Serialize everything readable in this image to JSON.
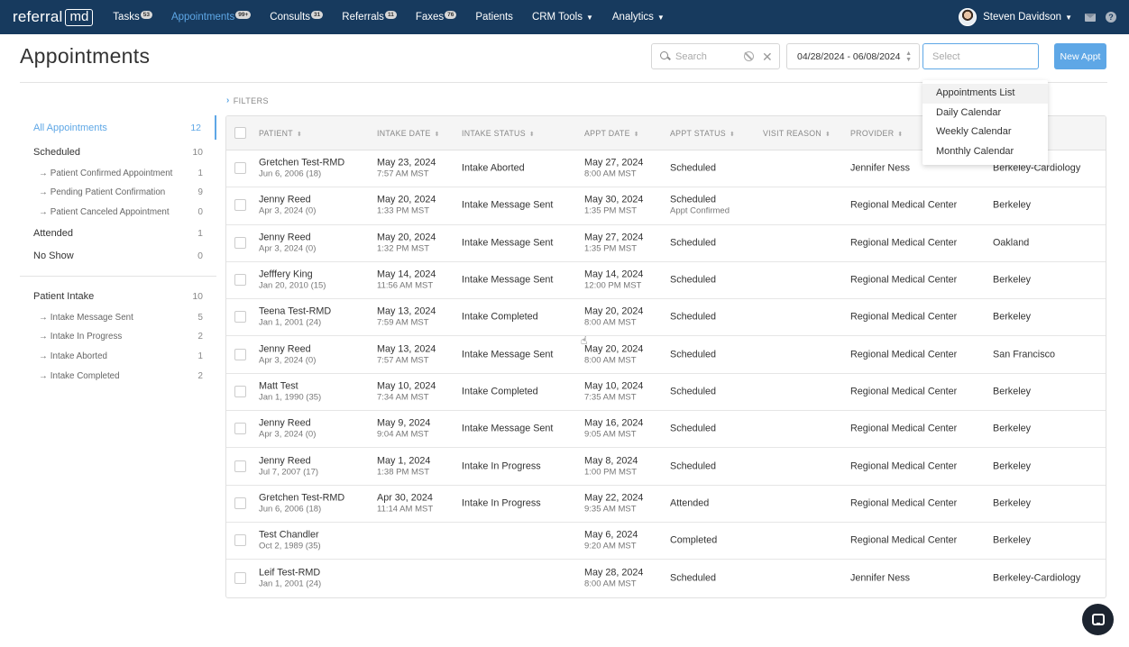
{
  "brand": {
    "logo_text": "referral",
    "logo_box": "md"
  },
  "nav": {
    "items": [
      {
        "label": "Tasks",
        "badge": "53",
        "active": false
      },
      {
        "label": "Appointments",
        "badge": "99+",
        "active": true
      },
      {
        "label": "Consults",
        "badge": "31",
        "active": false
      },
      {
        "label": "Referrals",
        "badge": "11",
        "active": false
      },
      {
        "label": "Faxes",
        "badge": "76",
        "active": false
      },
      {
        "label": "Patients",
        "badge": "",
        "active": false
      },
      {
        "label": "CRM Tools",
        "badge": "",
        "active": false,
        "dropdown": true
      },
      {
        "label": "Analytics",
        "badge": "",
        "active": false,
        "dropdown": true
      }
    ],
    "user_name": "Steven Davidson",
    "help_glyph": "?"
  },
  "page": {
    "title": "Appointments",
    "search_placeholder": "Search",
    "date_range": "04/28/2024 - 06/08/2024",
    "view_select_placeholder": "Select",
    "new_appt_label": "New Appt",
    "filters_label": "FILTERS"
  },
  "view_dropdown": {
    "options": [
      "Appointments List",
      "Daily Calendar",
      "Weekly Calendar",
      "Monthly Calendar"
    ]
  },
  "sidebar": {
    "all": {
      "label": "All Appointments",
      "count": "12"
    },
    "groups": [
      {
        "label": "Scheduled",
        "count": "10",
        "children": [
          {
            "label": "Patient Confirmed Appointment",
            "count": "1"
          },
          {
            "label": "Pending Patient Confirmation",
            "count": "9"
          },
          {
            "label": "Patient Canceled Appointment",
            "count": "0"
          }
        ]
      },
      {
        "label": "Attended",
        "count": "1",
        "children": []
      },
      {
        "label": "No Show",
        "count": "0",
        "children": []
      }
    ],
    "intake": {
      "label": "Patient Intake",
      "count": "10",
      "children": [
        {
          "label": "Intake Message Sent",
          "count": "5"
        },
        {
          "label": "Intake In Progress",
          "count": "2"
        },
        {
          "label": "Intake Aborted",
          "count": "1"
        },
        {
          "label": "Intake Completed",
          "count": "2"
        }
      ]
    }
  },
  "table": {
    "headers": [
      "PATIENT",
      "INTAKE DATE",
      "INTAKE STATUS",
      "APPT DATE",
      "APPT STATUS",
      "VISIT REASON",
      "PROVIDER"
    ],
    "rows": [
      {
        "patient": "Gretchen Test-RMD",
        "dob": "Jun 6, 2006 (18)",
        "intake_date": "May 23, 2024",
        "intake_time": "7:57 AM MST",
        "intake_status": "Intake Aborted",
        "appt_date": "May 27, 2024",
        "appt_time": "8:00 AM MST",
        "appt_status": "Scheduled",
        "appt_sub": "",
        "provider": "Jennifer Ness",
        "location": "Berkeley-Cardiology"
      },
      {
        "patient": "Jenny Reed",
        "dob": "Apr 3, 2024 (0)",
        "intake_date": "May 20, 2024",
        "intake_time": "1:33 PM MST",
        "intake_status": "Intake Message Sent",
        "appt_date": "May 30, 2024",
        "appt_time": "1:35 PM MST",
        "appt_status": "Scheduled",
        "appt_sub": "Appt Confirmed",
        "provider": "Regional Medical Center",
        "location": "Berkeley"
      },
      {
        "patient": "Jenny Reed",
        "dob": "Apr 3, 2024 (0)",
        "intake_date": "May 20, 2024",
        "intake_time": "1:32 PM MST",
        "intake_status": "Intake Message Sent",
        "appt_date": "May 27, 2024",
        "appt_time": "1:35 PM MST",
        "appt_status": "Scheduled",
        "appt_sub": "",
        "provider": "Regional Medical Center",
        "location": "Oakland"
      },
      {
        "patient": "Jefffery King",
        "dob": "Jan 20, 2010 (15)",
        "intake_date": "May 14, 2024",
        "intake_time": "11:56 AM MST",
        "intake_status": "Intake Message Sent",
        "appt_date": "May 14, 2024",
        "appt_time": "12:00 PM MST",
        "appt_status": "Scheduled",
        "appt_sub": "",
        "provider": "Regional Medical Center",
        "location": "Berkeley"
      },
      {
        "patient": "Teena Test-RMD",
        "dob": "Jan 1, 2001 (24)",
        "intake_date": "May 13, 2024",
        "intake_time": "7:59 AM MST",
        "intake_status": "Intake Completed",
        "appt_date": "May 20, 2024",
        "appt_time": "8:00 AM MST",
        "appt_status": "Scheduled",
        "appt_sub": "",
        "provider": "Regional Medical Center",
        "location": "Berkeley"
      },
      {
        "patient": "Jenny Reed",
        "dob": "Apr 3, 2024 (0)",
        "intake_date": "May 13, 2024",
        "intake_time": "7:57 AM MST",
        "intake_status": "Intake Message Sent",
        "appt_date": "May 20, 2024",
        "appt_time": "8:00 AM MST",
        "appt_status": "Scheduled",
        "appt_sub": "",
        "provider": "Regional Medical Center",
        "location": "San Francisco"
      },
      {
        "patient": "Matt Test",
        "dob": "Jan 1, 1990 (35)",
        "intake_date": "May 10, 2024",
        "intake_time": "7:34 AM MST",
        "intake_status": "Intake Completed",
        "appt_date": "May 10, 2024",
        "appt_time": "7:35 AM MST",
        "appt_status": "Scheduled",
        "appt_sub": "",
        "provider": "Regional Medical Center",
        "location": "Berkeley"
      },
      {
        "patient": "Jenny Reed",
        "dob": "Apr 3, 2024 (0)",
        "intake_date": "May 9, 2024",
        "intake_time": "9:04 AM MST",
        "intake_status": "Intake Message Sent",
        "appt_date": "May 16, 2024",
        "appt_time": "9:05 AM MST",
        "appt_status": "Scheduled",
        "appt_sub": "",
        "provider": "Regional Medical Center",
        "location": "Berkeley"
      },
      {
        "patient": "Jenny Reed",
        "dob": "Jul 7, 2007 (17)",
        "intake_date": "May 1, 2024",
        "intake_time": "1:38 PM MST",
        "intake_status": "Intake In Progress",
        "appt_date": "May 8, 2024",
        "appt_time": "1:00 PM MST",
        "appt_status": "Scheduled",
        "appt_sub": "",
        "provider": "Regional Medical Center",
        "location": "Berkeley"
      },
      {
        "patient": "Gretchen Test-RMD",
        "dob": "Jun 6, 2006 (18)",
        "intake_date": "Apr 30, 2024",
        "intake_time": "11:14 AM MST",
        "intake_status": "Intake In Progress",
        "appt_date": "May 22, 2024",
        "appt_time": "9:35 AM MST",
        "appt_status": "Attended",
        "appt_sub": "",
        "provider": "Regional Medical Center",
        "location": "Berkeley"
      },
      {
        "patient": "Test Chandler",
        "dob": "Oct 2, 1989 (35)",
        "intake_date": "",
        "intake_time": "",
        "intake_status": "",
        "appt_date": "May 6, 2024",
        "appt_time": "9:20 AM MST",
        "appt_status": "Completed",
        "appt_sub": "",
        "provider": "Regional Medical Center",
        "location": "Berkeley"
      },
      {
        "patient": "Leif Test-RMD",
        "dob": "Jan 1, 2001 (24)",
        "intake_date": "",
        "intake_time": "",
        "intake_status": "",
        "appt_date": "May 28, 2024",
        "appt_time": "8:00 AM MST",
        "appt_status": "Scheduled",
        "appt_sub": "",
        "provider": "Jennifer Ness",
        "location": "Berkeley-Cardiology"
      }
    ]
  },
  "colors": {
    "nav_bg": "#173a5e",
    "accent": "#5ea7e6"
  },
  "icons": {
    "search": "search-icon",
    "clear": "ban-icon",
    "close": "close-icon",
    "chat": "chat-icon",
    "mail": "mail-icon",
    "help": "help-icon"
  }
}
